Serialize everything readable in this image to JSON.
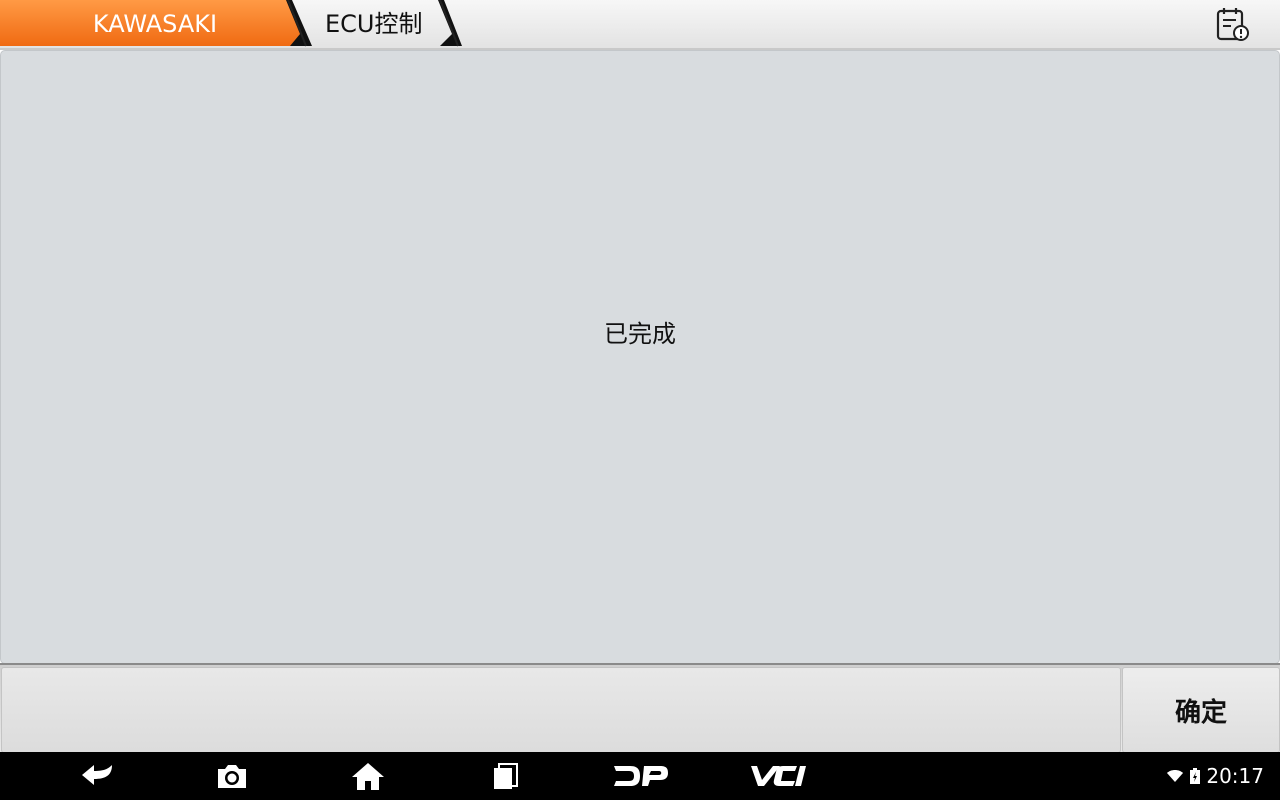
{
  "breadcrumb": {
    "items": [
      {
        "label": "KAWASAKI",
        "active": true
      },
      {
        "label": "ECU控制",
        "active": false
      }
    ]
  },
  "header": {
    "report_icon": "diagnostic-report-icon"
  },
  "main": {
    "message": "已完成"
  },
  "actions": {
    "confirm_label": "确定"
  },
  "navbar": {
    "icons": [
      "back-icon",
      "screenshot-icon",
      "home-icon",
      "recent-apps-icon",
      "dp-icon",
      "vci-icon"
    ],
    "dp_label": "DP",
    "vci_label": "VCI"
  },
  "status": {
    "time": "20:17",
    "icons": [
      "wifi-icon",
      "battery-charging-icon"
    ]
  },
  "colors": {
    "accent": "#f47a20",
    "panel": "#d8dcdf",
    "nav": "#000000"
  }
}
